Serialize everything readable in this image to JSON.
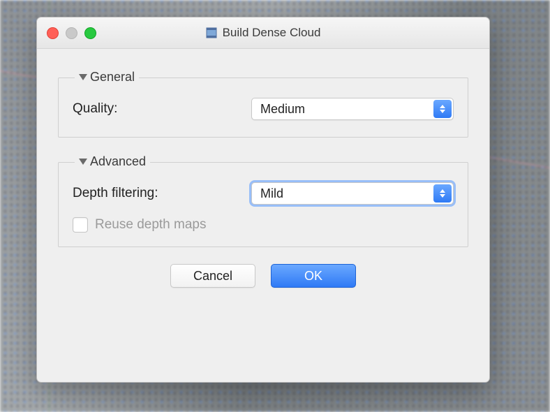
{
  "window": {
    "title": "Build Dense Cloud"
  },
  "groups": {
    "general": {
      "legend": "General",
      "quality_label": "Quality:",
      "quality_value": "Medium"
    },
    "advanced": {
      "legend": "Advanced",
      "depth_filtering_label": "Depth filtering:",
      "depth_filtering_value": "Mild",
      "reuse_depth_maps_label": "Reuse depth maps",
      "reuse_depth_maps_checked": false
    }
  },
  "buttons": {
    "cancel": "Cancel",
    "ok": "OK"
  }
}
